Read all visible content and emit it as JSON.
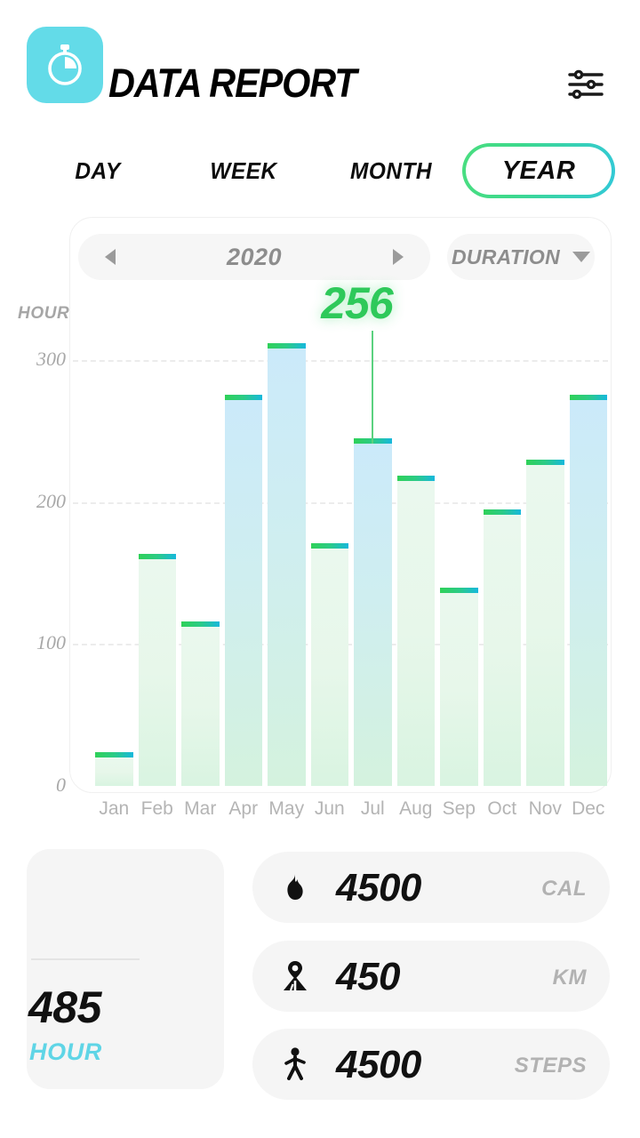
{
  "header": {
    "title": "DATA REPORT",
    "back_icon": "arrow-left-icon",
    "filter_icon": "sliders-icon"
  },
  "tabs": [
    {
      "label": "DAY",
      "selected": false
    },
    {
      "label": "WEEK",
      "selected": false
    },
    {
      "label": "MONTH",
      "selected": false
    },
    {
      "label": "YEAR",
      "selected": true
    }
  ],
  "chart_controls": {
    "prev_icon": "triangle-left-icon",
    "year": "2020",
    "next_icon": "triangle-right-icon",
    "metric": "DURATION",
    "metric_caret": "triangle-down-icon"
  },
  "chart_data": {
    "type": "bar",
    "title": "",
    "xlabel": "",
    "ylabel": "HOUR",
    "categories": [
      "Jan",
      "Feb",
      "Mar",
      "Apr",
      "May",
      "Jun",
      "Jul",
      "Aug",
      "Sep",
      "Oct",
      "Nov",
      "Dec"
    ],
    "values": [
      20,
      160,
      112,
      272,
      308,
      167,
      241,
      215,
      136,
      191,
      226,
      272
    ],
    "ylim": [
      0,
      330
    ],
    "yticks": [
      "0",
      "100",
      "200",
      "300"
    ],
    "ytick_values": [
      0,
      100,
      200,
      300
    ],
    "grid": true,
    "legend": null,
    "highlight": {
      "category": "Jul",
      "label": "256",
      "color": "#2ec95a"
    },
    "bar_cap_gradient": [
      "#2fd158",
      "#17b8dd"
    ],
    "bar_body_gradient": [
      "#cbeafa",
      "#d4f2de"
    ]
  },
  "summary": {
    "icon": "stopwatch-icon",
    "value": "485",
    "unit": "HOUR",
    "accent": "#63dbe8"
  },
  "stats": [
    {
      "icon": "flame-icon",
      "value": "4500",
      "unit": "CAL"
    },
    {
      "icon": "route-pin-icon",
      "value": "450",
      "unit": "KM"
    },
    {
      "icon": "walking-icon",
      "value": "4500",
      "unit": "STEPS"
    }
  ]
}
